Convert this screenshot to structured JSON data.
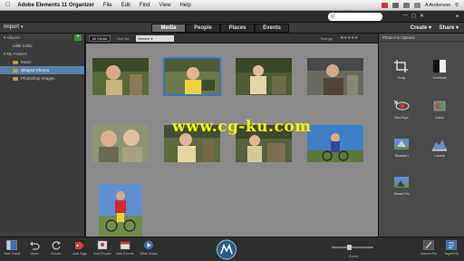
{
  "menubar": {
    "app_name": "Adobe Elements 11 Organizer",
    "items": [
      "File",
      "Edit",
      "Find",
      "View",
      "Help"
    ],
    "user": "A Anderson"
  },
  "toolbar": {
    "import_label": "Import",
    "tabs": [
      {
        "label": "Media",
        "active": true
      },
      {
        "label": "People",
        "active": false
      },
      {
        "label": "Places",
        "active": false
      },
      {
        "label": "Events",
        "active": false
      }
    ],
    "create_label": "Create",
    "share_label": "Share"
  },
  "sidebar": {
    "catalogs_header": "Albums",
    "catalog_item": "Little Coho",
    "folders_header": "My Folders",
    "folders": [
      {
        "label": "Music",
        "selected": false
      },
      {
        "label": "Shaped Shares",
        "selected": true
      },
      {
        "label": "Photoshop Images",
        "selected": false
      }
    ]
  },
  "gridbar": {
    "albums_button": "All Media",
    "sort_label": "Sort By:",
    "sort_value": "Newest",
    "ratings_label": "Ratings"
  },
  "rpanel": {
    "header": "Photo Fix Options",
    "tools": [
      {
        "label": "Crop",
        "icon": "crop-icon"
      },
      {
        "label": "Contrast",
        "icon": "contrast-icon"
      },
      {
        "label": "Red Eye",
        "icon": "red-eye-icon"
      },
      {
        "label": "Color",
        "icon": "color-icon"
      },
      {
        "label": "Sharpen",
        "icon": "sharpen-icon"
      },
      {
        "label": "Levels",
        "icon": "levels-icon"
      },
      {
        "label": "Smart Fix",
        "icon": "smart-fix-icon"
      }
    ]
  },
  "bottombar": {
    "items": [
      {
        "label": "Hide Panel",
        "icon": "hide-panel-icon"
      },
      {
        "label": "Undo",
        "icon": "undo-icon"
      },
      {
        "label": "Rotate",
        "icon": "rotate-icon"
      },
      {
        "label": "Add Tags",
        "icon": "tag-icon"
      },
      {
        "label": "Add Photos",
        "icon": "add-photos-icon"
      },
      {
        "label": "Add Events",
        "icon": "add-event-icon"
      },
      {
        "label": "Slide Show",
        "icon": "slideshow-icon"
      }
    ],
    "zoom_label": "Zoom",
    "zoom_level": 0.42,
    "instant_fix_label": "Instant Fix",
    "tags_label": "Tags/Info"
  },
  "watermark": "www.cg-ku.com",
  "colors": {
    "selection": "#3b72c4",
    "watermark": "#f5f500",
    "grid_bg": "#8a8a8a",
    "active_tab": "#6a6a6a"
  }
}
